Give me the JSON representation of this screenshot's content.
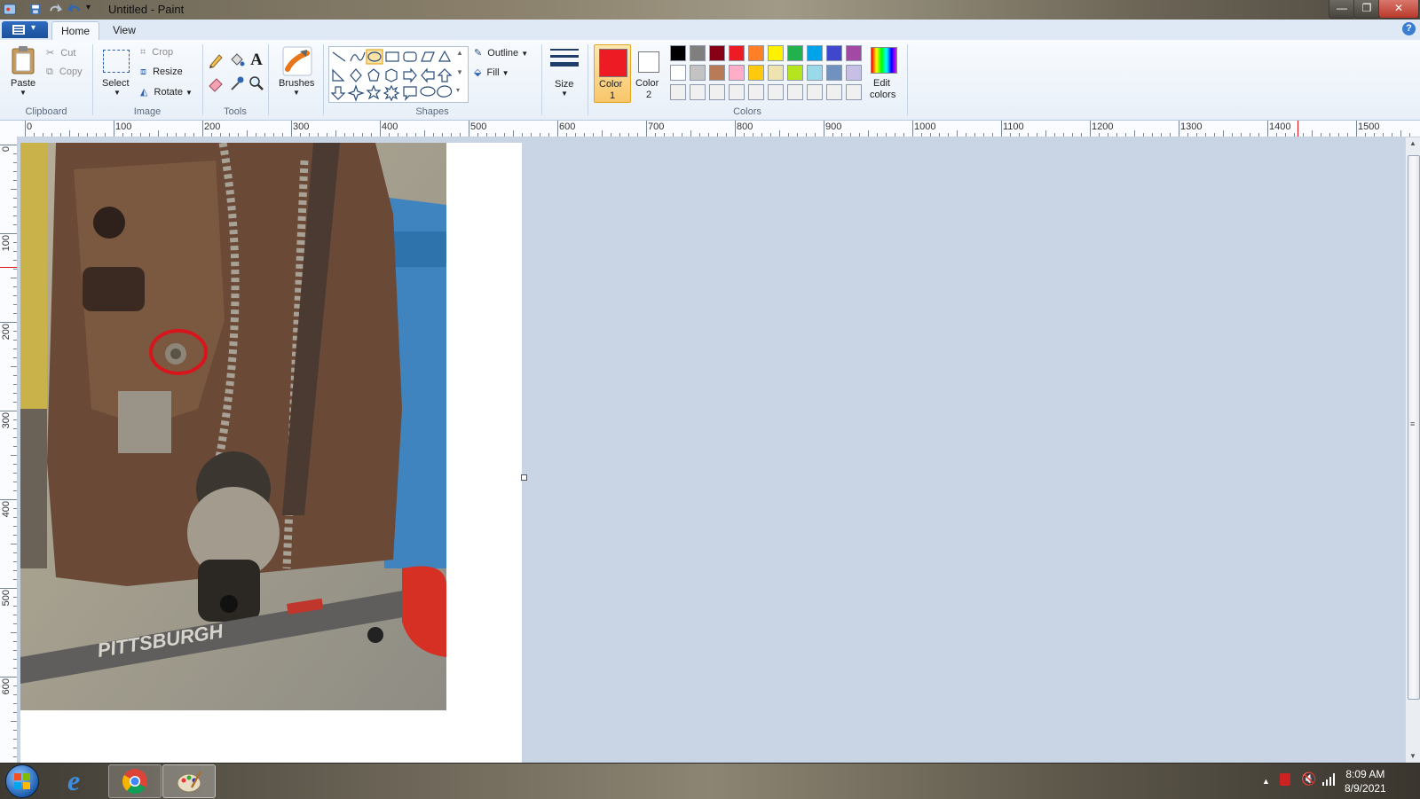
{
  "window": {
    "title": "Untitled - Paint",
    "controls": {
      "minimize": "—",
      "maximize": "❐",
      "close": "✕"
    }
  },
  "menu": {
    "tabs": [
      {
        "label": "Home",
        "active": true
      },
      {
        "label": "View",
        "active": false
      }
    ]
  },
  "ribbon": {
    "clipboard": {
      "label": "Clipboard",
      "paste": "Paste",
      "cut": "Cut",
      "copy": "Copy"
    },
    "image": {
      "label": "Image",
      "select": "Select",
      "crop": "Crop",
      "resize": "Resize",
      "rotate": "Rotate"
    },
    "tools": {
      "label": "Tools"
    },
    "brushes": {
      "label": "Brushes"
    },
    "shapes": {
      "label": "Shapes",
      "outline": "Outline",
      "fill": "Fill"
    },
    "size": {
      "label": "Size"
    },
    "colors": {
      "label": "Colors",
      "color1": {
        "label": "Color",
        "num": "1",
        "value": "#ed1c24"
      },
      "color2": {
        "label": "Color",
        "num": "2",
        "value": "#ffffff"
      },
      "edit": {
        "label1": "Edit",
        "label2": "colors"
      },
      "palette_row1": [
        "#000000",
        "#7f7f7f",
        "#880015",
        "#ed1c24",
        "#ff7f27",
        "#fff200",
        "#22b14c",
        "#00a2e8",
        "#3f48cc",
        "#a349a4"
      ],
      "palette_row2": [
        "#ffffff",
        "#c3c3c3",
        "#b97a57",
        "#ffaec9",
        "#ffc90e",
        "#efe4b0",
        "#b5e61d",
        "#99d9ea",
        "#7092be",
        "#c8bfe7"
      ],
      "palette_row3": [
        "#f0f0f0",
        "#f0f0f0",
        "#f0f0f0",
        "#f0f0f0",
        "#f0f0f0",
        "#f0f0f0",
        "#f0f0f0",
        "#f0f0f0",
        "#f0f0f0",
        "#f0f0f0"
      ]
    }
  },
  "rulers": {
    "horizontal": [
      "0",
      "100",
      "200",
      "300",
      "400",
      "500",
      "600",
      "700",
      "800",
      "900",
      "1000",
      "1100",
      "1200",
      "1300",
      "1400",
      "1500"
    ],
    "vertical": [
      "0",
      "100",
      "200",
      "300",
      "400",
      "500",
      "600"
    ]
  },
  "canvas": {
    "photo_text": "PITTSBURGH"
  },
  "taskbar": {
    "time": "8:09 AM",
    "date": "8/9/2021"
  }
}
